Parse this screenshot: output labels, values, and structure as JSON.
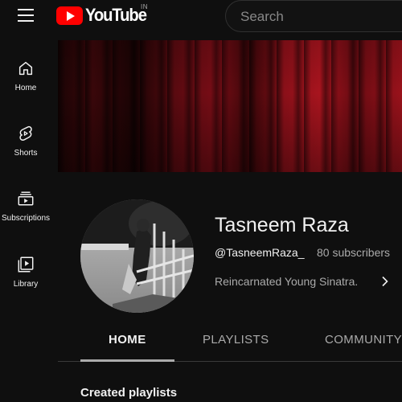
{
  "topbar": {
    "logo_text": "YouTube",
    "region": "IN",
    "search_placeholder": "Search"
  },
  "sidebar": {
    "items": [
      {
        "label": "Home",
        "icon": "home-icon"
      },
      {
        "label": "Shorts",
        "icon": "shorts-icon"
      },
      {
        "label": "Subscriptions",
        "icon": "subscriptions-icon"
      },
      {
        "label": "Library",
        "icon": "library-icon"
      }
    ]
  },
  "channel": {
    "name": "Tasneem Raza",
    "handle": "@TasneemRaza_",
    "subscribers": "80 subscribers",
    "description": "Reincarnated Young Sinatra."
  },
  "tabs": [
    {
      "label": "HOME",
      "active": true
    },
    {
      "label": "PLAYLISTS",
      "active": false
    },
    {
      "label": "COMMUNITY",
      "active": false
    }
  ],
  "content": {
    "section_title": "Created playlists"
  },
  "colors": {
    "background": "#0f0f0f",
    "brand_red": "#ff0000",
    "text_primary": "#f1f1f1",
    "text_secondary": "#aaaaaa"
  }
}
